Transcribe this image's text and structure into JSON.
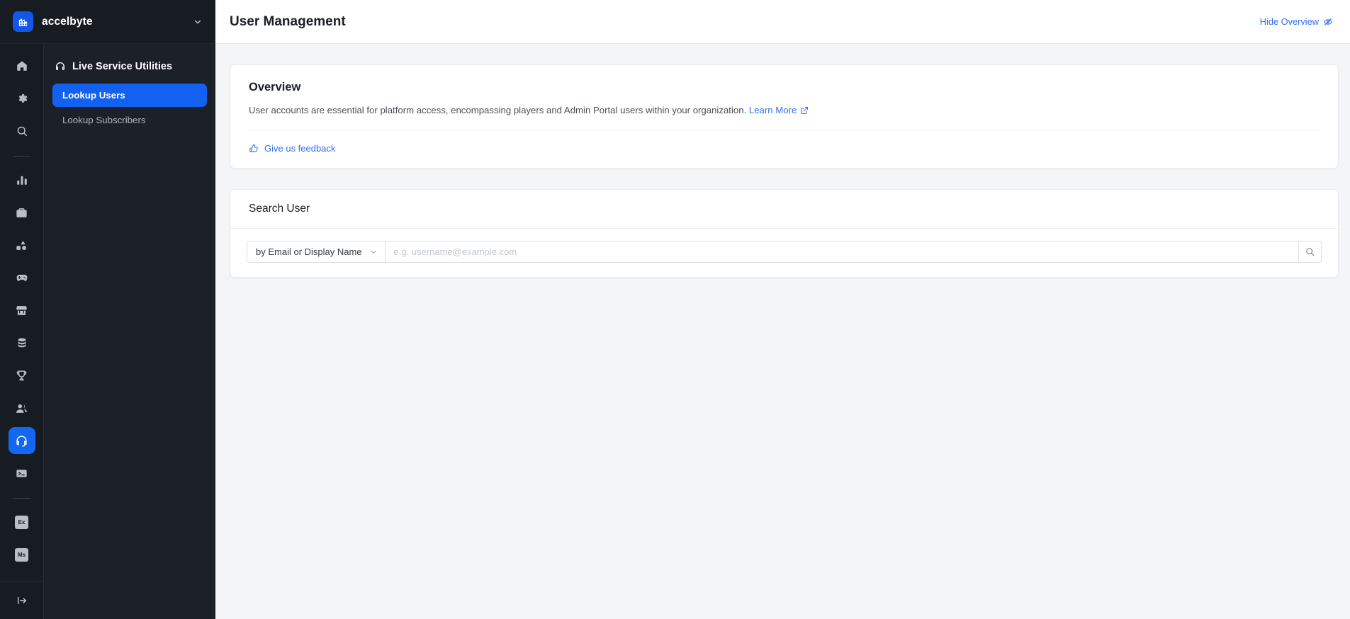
{
  "brand": {
    "name": "accelbyte",
    "logo_icon": "building-icon",
    "caret_icon": "chevron-down-icon"
  },
  "rail": {
    "items": [
      {
        "name": "home",
        "icon": "home-icon",
        "active": false
      },
      {
        "name": "settings",
        "icon": "gear-icon",
        "active": false
      },
      {
        "name": "search",
        "icon": "search-icon",
        "active": false
      },
      {
        "name": "analytics",
        "icon": "bar-chart-icon",
        "active": false
      },
      {
        "name": "toolkit",
        "icon": "briefcase-icon",
        "active": false
      },
      {
        "name": "content",
        "icon": "shapes-icon",
        "active": false
      },
      {
        "name": "game",
        "icon": "gamepad-icon",
        "active": false
      },
      {
        "name": "store",
        "icon": "storefront-icon",
        "active": false
      },
      {
        "name": "storage",
        "icon": "database-icon",
        "active": false
      },
      {
        "name": "achievements",
        "icon": "trophy-icon",
        "active": false
      },
      {
        "name": "users",
        "icon": "people-icon",
        "active": false
      },
      {
        "name": "live-service-utilities",
        "icon": "headset-icon",
        "active": true
      },
      {
        "name": "console",
        "icon": "terminal-icon",
        "active": false
      },
      {
        "name": "extend",
        "icon": "ex-doc-icon",
        "label": "Ex",
        "active": false
      },
      {
        "name": "multiplayer-servers",
        "icon": "ms-doc-icon",
        "label": "Ms",
        "active": false
      }
    ],
    "collapse_icon": "collapse-panel-icon"
  },
  "subnav": {
    "header": {
      "label": "Live Service Utilities",
      "icon": "headset-icon"
    },
    "items": [
      {
        "label": "Lookup Users",
        "active": true
      },
      {
        "label": "Lookup Subscribers",
        "active": false
      }
    ]
  },
  "topbar": {
    "title": "User Management",
    "hide_overview_label": "Hide Overview",
    "hide_overview_icon": "eye-off-icon"
  },
  "overview": {
    "title": "Overview",
    "description": "User accounts are essential for platform access, encompassing players and Admin Portal users within your organization.",
    "learn_more_label": "Learn More",
    "learn_more_icon": "external-link-icon",
    "feedback_label": "Give us feedback",
    "feedback_icon": "thumbs-up-icon"
  },
  "search_user": {
    "title": "Search User",
    "select_value": "by Email or Display Name",
    "select_caret_icon": "chevron-down-icon",
    "input_value": "",
    "input_placeholder": "e.g. username@example.com",
    "search_button_icon": "search-icon"
  },
  "colors": {
    "accent_blue": "#1261f0",
    "link_blue": "#2f6ef3",
    "sidebar_dark": "#171b22",
    "subnav_dark": "#1c2028",
    "page_bg": "#f4f5f7"
  }
}
